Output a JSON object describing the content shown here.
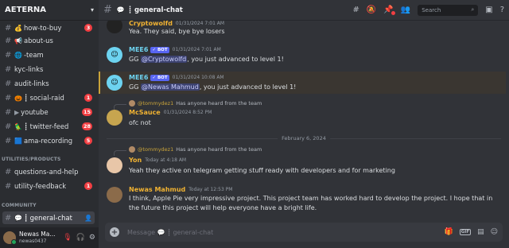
{
  "server": {
    "name": "AETERNA"
  },
  "channels": [
    {
      "emoji": "💰",
      "label": "how-to-buy",
      "badge": "3",
      "dim": false
    },
    {
      "emoji": "📢",
      "label": "about-us",
      "badge": null,
      "dim": false
    },
    {
      "emoji": "🌐",
      "label": "-team",
      "badge": null,
      "dim": false
    },
    {
      "emoji": "",
      "label": "kyc-links",
      "badge": null,
      "dim": false
    },
    {
      "emoji": "",
      "label": "audit-links",
      "badge": null,
      "dim": false
    },
    {
      "emoji": "🎃",
      "label": "┋ social-raid",
      "badge": "1",
      "dim": false
    },
    {
      "emoji": "",
      "label": "youtube",
      "badge": "15",
      "dim": false
    },
    {
      "emoji": "🦜",
      "label": "┋ twitter-feed",
      "badge": "28",
      "dim": false
    },
    {
      "emoji": "🟦",
      "label": "ama-recording",
      "badge": "5",
      "dim": false
    }
  ],
  "categories": {
    "utilities": "UTILITIES/PRODUCTS",
    "community": "COMMUNITY"
  },
  "utility_channels": [
    {
      "label": "questions-and-help",
      "badge": null
    },
    {
      "label": "utility-feedback",
      "badge": "1"
    }
  ],
  "active_channel": {
    "emoji": "💬",
    "label": "┋ general-chat"
  },
  "user": {
    "name": "Newas Ma...",
    "tag": "newas0437"
  },
  "topbar": {
    "title": "┋ general-chat",
    "search_placeholder": "Search"
  },
  "messages": [
    {
      "author": "Cryptowolfd",
      "author_color": "#f0b232",
      "time": "01/31/2024 7:01 AM",
      "text": "Yea. They said, bye bye losers",
      "bot": false
    },
    {
      "author": "MEE6",
      "author_color": "#6dd3f0",
      "bot_label": "✓ BOT",
      "time": "01/31/2024 7:01 AM",
      "text_pre": "GG ",
      "mention": "@Cryptowolfd",
      "text_post": ", you just advanced to level 1!"
    },
    {
      "author": "MEE6",
      "author_color": "#6dd3f0",
      "bot_label": "✓ BOT",
      "time": "01/31/2024 10:08 AM",
      "text_pre": "GG ",
      "mention": "@Newas Mahmud",
      "text_post": ", you just advanced to level 1!"
    },
    {
      "reply_name": "@tommydez1",
      "reply_text": "Has anyone heard from the team",
      "author": "McSauce",
      "author_color": "#f0b232",
      "time": "01/31/2024 8:52 PM",
      "text": "ofc not"
    },
    {
      "reply_name": "@tommydez1",
      "reply_text": "Has anyone heard from the team",
      "author": "Yon",
      "author_color": "#f0b232",
      "time": "Today at 4:18 AM",
      "text": "Yeah they active on telegram getting stuff ready with developers and for marketing"
    },
    {
      "author": "Newas Mahmud",
      "author_color": "#f0b232",
      "time": "Today at 12:53 PM",
      "text": "I think, Apple Pie very impressive project. This project team has worked hard to develop the project. I hope that in the future this project will help everyone have a bright life."
    }
  ],
  "date_divider": "February 6, 2024",
  "composer": {
    "placeholder": "Message 💬 ┋ general-chat"
  }
}
